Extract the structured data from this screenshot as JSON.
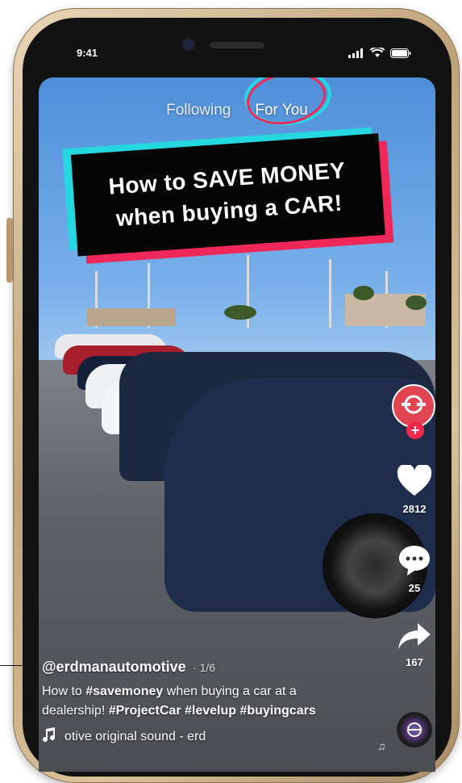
{
  "status_bar": {
    "time": "9:41"
  },
  "top_tabs": [
    {
      "label": "Following",
      "active": false
    },
    {
      "label": "For You",
      "active": true
    }
  ],
  "banner": {
    "line1": "How to SAVE MONEY",
    "line2": "when buying a CAR!"
  },
  "right_rail": {
    "likes": "2812",
    "comments": "25",
    "shares": "167"
  },
  "caption": {
    "username": "@erdmanautomotive",
    "page_indicator": "· 1/6",
    "desc_pre": "How to ",
    "desc_tag1": "#savemoney",
    "desc_mid": " when buying a car at a dealership! ",
    "desc_tags": "#ProjectCar #levelup #buyingcars",
    "sound": "otive   original sound - erd"
  },
  "colors": {
    "banner_cyan": "#25d8e0",
    "banner_pink": "#f0285a",
    "follow_badge": "#f2294e"
  },
  "icons": [
    "signal-icon",
    "wifi-icon",
    "battery-icon",
    "heart-icon",
    "comment-icon",
    "share-icon",
    "music-note-icon",
    "music-disc-icon",
    "plus-icon",
    "wrench-logo-icon"
  ]
}
